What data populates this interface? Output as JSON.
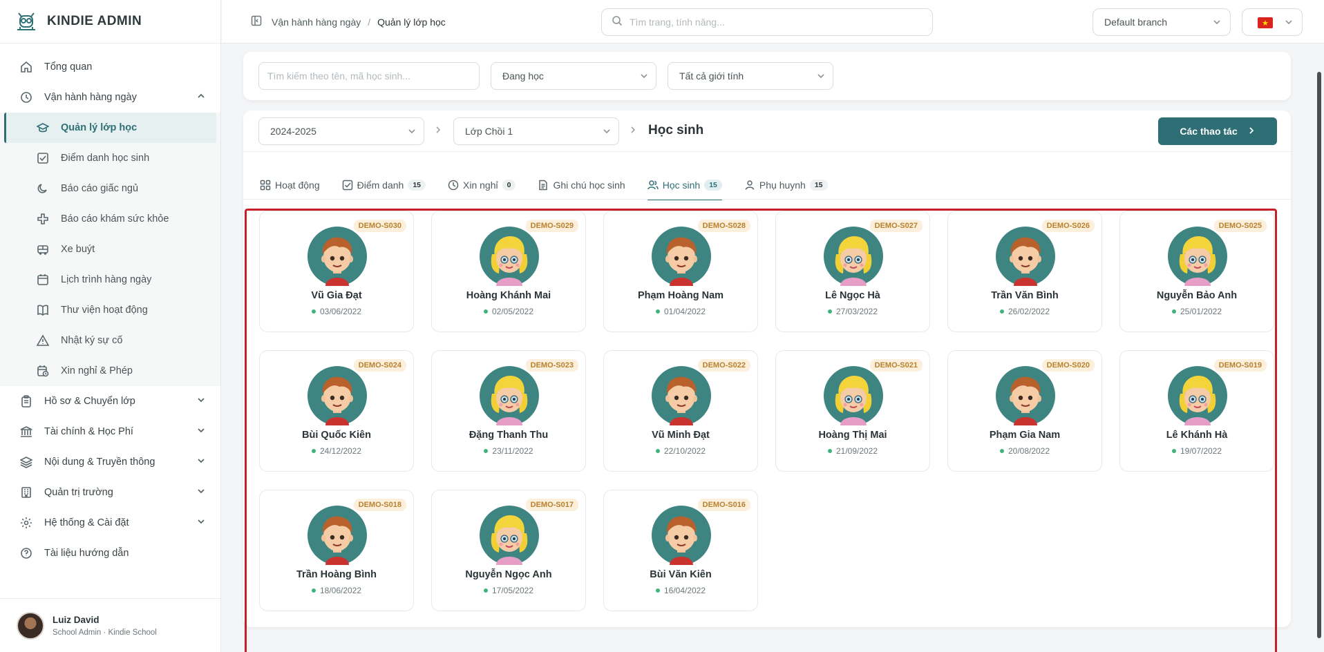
{
  "brand": {
    "name": "KINDIE ADMIN"
  },
  "sidebar": {
    "overview": "Tổng quan",
    "daily_ops": "Vận hành hàng ngày",
    "sub_items": [
      {
        "label": "Quản lý lớp học",
        "icon": "graduation-cap-icon"
      },
      {
        "label": "Điểm danh học sinh",
        "icon": "checkbox-icon"
      },
      {
        "label": "Báo cáo giấc ngủ",
        "icon": "moon-icon"
      },
      {
        "label": "Báo cáo khám sức khỏe",
        "icon": "health-cross-icon"
      },
      {
        "label": "Xe buýt",
        "icon": "bus-icon"
      },
      {
        "label": "Lịch trình hàng ngày",
        "icon": "calendar-icon"
      },
      {
        "label": "Thư viện hoạt động",
        "icon": "book-icon"
      },
      {
        "label": "Nhật ký sự cố",
        "icon": "warning-icon"
      },
      {
        "label": "Xin nghỉ & Phép",
        "icon": "calendar-clock-icon"
      }
    ],
    "groups": [
      {
        "label": "Hồ sơ & Chuyển lớp",
        "icon": "clipboard-icon"
      },
      {
        "label": "Tài chính & Học Phí",
        "icon": "bank-icon"
      },
      {
        "label": "Nội dung & Truyền thông",
        "icon": "layers-icon"
      },
      {
        "label": "Quản trị trường",
        "icon": "building-icon"
      },
      {
        "label": "Hệ thống & Cài đặt",
        "icon": "gear-icon"
      }
    ],
    "docs": "Tài liệu hướng dẫn"
  },
  "user": {
    "name": "Luiz David",
    "role": "School Admin · Kindie School"
  },
  "topbar": {
    "breadcrumb": [
      "Vận hành hàng ngày",
      "Quản lý lớp học"
    ],
    "search_placeholder": "Tìm trang, tính năng...",
    "branch": "Default branch"
  },
  "filters": {
    "search_placeholder": "Tìm kiếm theo tên, mã học sinh...",
    "status": "Đang học",
    "gender": "Tất cả giới tính"
  },
  "context": {
    "year": "2024-2025",
    "class": "Lớp Chồi 1",
    "title": "Học sinh",
    "actions": "Các thao tác"
  },
  "tabs": [
    {
      "label": "Hoạt động",
      "badge": ""
    },
    {
      "label": "Điểm danh",
      "badge": "15"
    },
    {
      "label": "Xin nghỉ",
      "badge": "0"
    },
    {
      "label": "Ghi chú học sinh",
      "badge": ""
    },
    {
      "label": "Học sinh",
      "badge": "15"
    },
    {
      "label": "Phụ huynh",
      "badge": "15"
    }
  ],
  "students": [
    {
      "code": "DEMO-S030",
      "name": "Vũ Gia Đạt",
      "dob": "03/06/2022",
      "gender": "boy"
    },
    {
      "code": "DEMO-S029",
      "name": "Hoàng Khánh Mai",
      "dob": "02/05/2022",
      "gender": "girl"
    },
    {
      "code": "DEMO-S028",
      "name": "Phạm Hoàng Nam",
      "dob": "01/04/2022",
      "gender": "boy"
    },
    {
      "code": "DEMO-S027",
      "name": "Lê Ngọc Hà",
      "dob": "27/03/2022",
      "gender": "girl"
    },
    {
      "code": "DEMO-S026",
      "name": "Trần Văn Bình",
      "dob": "26/02/2022",
      "gender": "boy"
    },
    {
      "code": "DEMO-S025",
      "name": "Nguyễn Bảo Anh",
      "dob": "25/01/2022",
      "gender": "girl"
    },
    {
      "code": "DEMO-S024",
      "name": "Bùi Quốc Kiên",
      "dob": "24/12/2022",
      "gender": "boy"
    },
    {
      "code": "DEMO-S023",
      "name": "Đặng Thanh Thu",
      "dob": "23/11/2022",
      "gender": "girl"
    },
    {
      "code": "DEMO-S022",
      "name": "Vũ Minh Đạt",
      "dob": "22/10/2022",
      "gender": "boy"
    },
    {
      "code": "DEMO-S021",
      "name": "Hoàng Thị Mai",
      "dob": "21/09/2022",
      "gender": "girl"
    },
    {
      "code": "DEMO-S020",
      "name": "Phạm Gia Nam",
      "dob": "20/08/2022",
      "gender": "boy"
    },
    {
      "code": "DEMO-S019",
      "name": "Lê Khánh Hà",
      "dob": "19/07/2022",
      "gender": "girl"
    },
    {
      "code": "DEMO-S018",
      "name": "Trần Hoàng Bình",
      "dob": "18/06/2022",
      "gender": "boy"
    },
    {
      "code": "DEMO-S017",
      "name": "Nguyễn Ngọc Anh",
      "dob": "17/05/2022",
      "gender": "girl"
    },
    {
      "code": "DEMO-S016",
      "name": "Bùi Văn Kiên",
      "dob": "16/04/2022",
      "gender": "boy"
    }
  ],
  "colors": {
    "primary": "#2e6f76",
    "status_active": "#3fb47a",
    "highlight_frame": "#c8202a"
  }
}
